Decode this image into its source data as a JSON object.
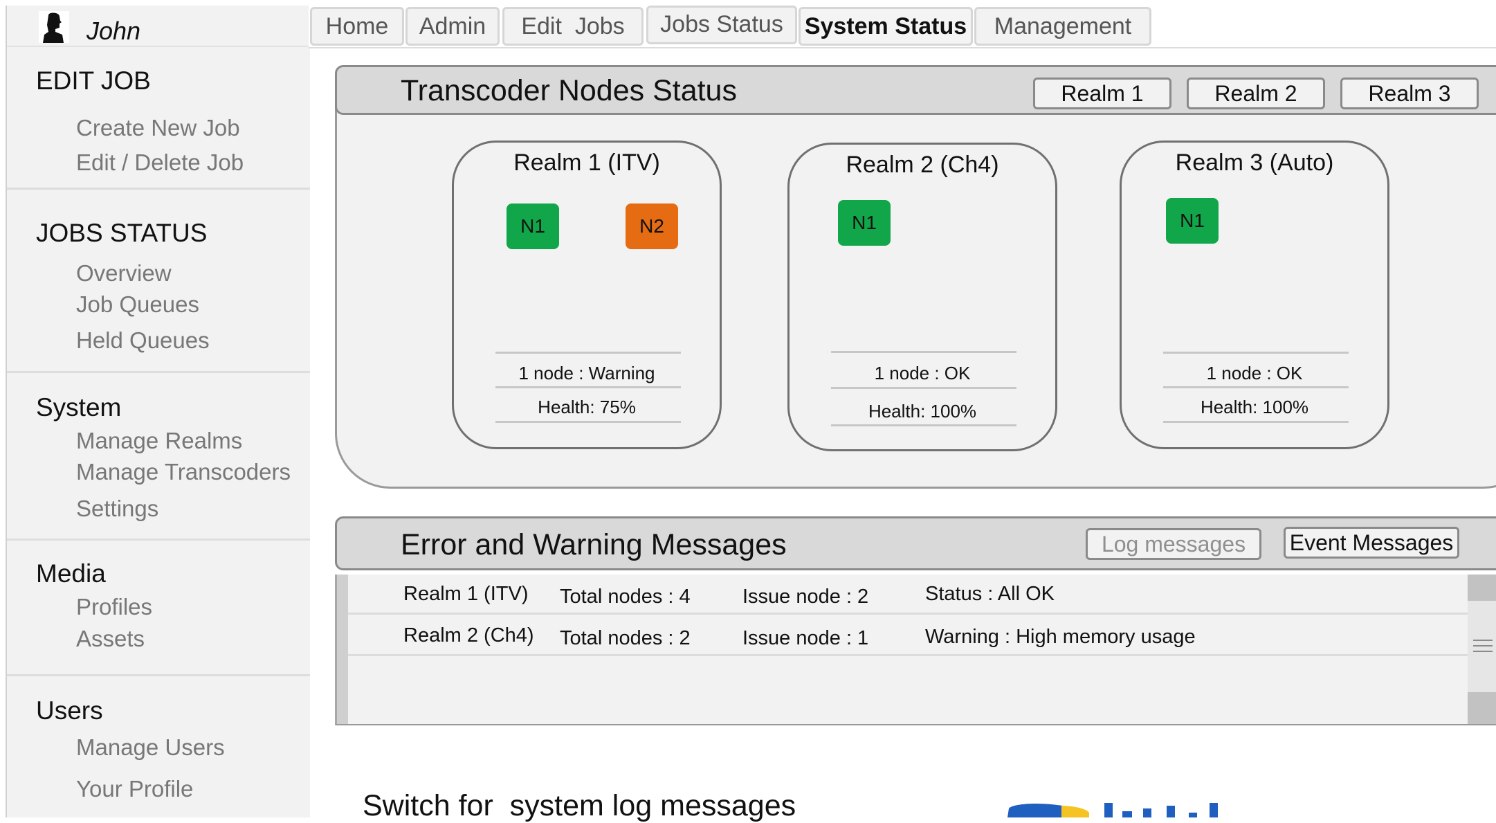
{
  "user": {
    "name": "John",
    "avatar_icon": "user-silhouette-icon"
  },
  "nav": {
    "tabs": [
      {
        "label": "Home"
      },
      {
        "label": "Admin"
      },
      {
        "label": "Edit  Jobs"
      },
      {
        "label": "Jobs Status"
      },
      {
        "label": "System Status",
        "active": true
      },
      {
        "label": "Management"
      }
    ]
  },
  "sidebar": {
    "sections": [
      {
        "title": "EDIT JOB",
        "items": [
          "Create New Job",
          "Edit / Delete Job"
        ]
      },
      {
        "title": "JOBS STATUS",
        "items": [
          "Overview",
          "Job Queues",
          "Held Queues"
        ]
      },
      {
        "title": "System",
        "items": [
          "Manage Realms",
          "Manage Transcoders",
          "Settings"
        ]
      },
      {
        "title": "Media",
        "items": [
          "Profiles",
          "Assets"
        ]
      },
      {
        "title": "Users",
        "items": [
          "Manage Users",
          "Your Profile"
        ]
      }
    ]
  },
  "nodes_panel": {
    "title": "Transcoder Nodes Status",
    "realm_buttons": [
      "Realm 1",
      "Realm 2",
      "Realm 3"
    ],
    "realms": [
      {
        "name": "Realm 1 (ITV)",
        "nodes": [
          {
            "label": "N1",
            "status": "ok"
          },
          {
            "label": "N2",
            "status": "warning"
          }
        ],
        "summary": "1 node : Warning",
        "health": "Health: 75%"
      },
      {
        "name": "Realm 2 (Ch4)",
        "nodes": [
          {
            "label": "N1",
            "status": "ok"
          }
        ],
        "summary": "1 node : OK",
        "health": "Health: 100%"
      },
      {
        "name": "Realm 3 (Auto)",
        "nodes": [
          {
            "label": "N1",
            "status": "ok"
          }
        ],
        "summary": "1 node : OK",
        "health": "Health: 100%"
      }
    ]
  },
  "messages_panel": {
    "title": "Error and Warning Messages",
    "log_button": "Log messages",
    "event_button": "Event Messages",
    "rows": [
      {
        "realm": "Realm 1 (ITV)",
        "total": "Total nodes : 4",
        "issue": "Issue node : 2",
        "status": "Status : All OK"
      },
      {
        "realm": "Realm 2 (Ch4)",
        "total": "Total nodes : 2",
        "issue": "Issue node : 1",
        "status": "Warning : High memory usage"
      }
    ]
  },
  "annotation": "Switch for  system log messages",
  "colors": {
    "ok": "#12a64a",
    "warning": "#e56c12",
    "logo_blue": "#1f5fbf",
    "logo_yellow": "#f6c324"
  }
}
